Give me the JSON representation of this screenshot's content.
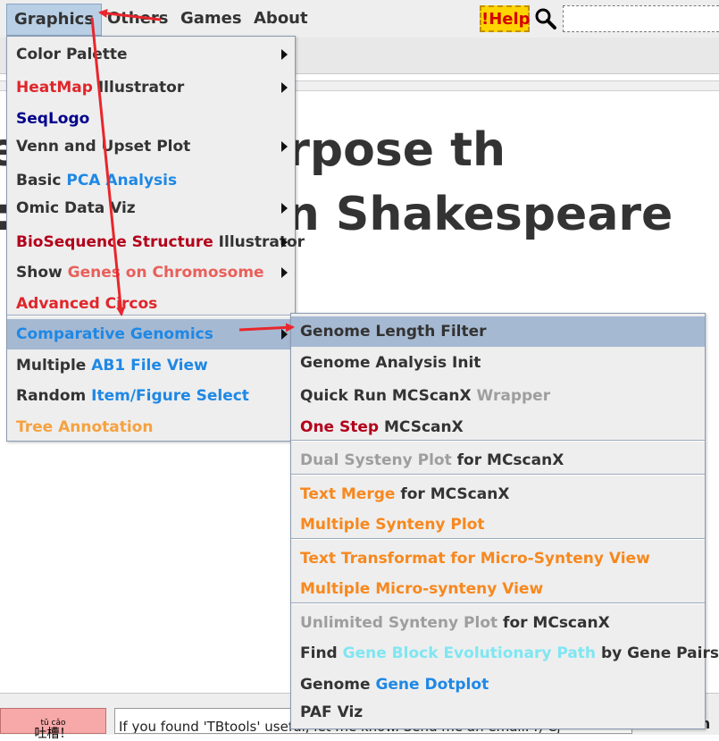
{
  "menubar": {
    "items": [
      "Graphics",
      "Others",
      "Games",
      "About"
    ],
    "help_label": "!Help",
    "search_icon": "magnifier-icon"
  },
  "background": {
    "line1": "e up the purpose th",
    "line2": "lian Shakespeare"
  },
  "graphics_menu": {
    "items": [
      {
        "parts": [
          {
            "t": "Color Palette",
            "c": "dark"
          }
        ],
        "submenu": true
      },
      {
        "parts": [
          {
            "t": "HeatMap",
            "c": "red"
          },
          {
            "t": " Illustrator",
            "c": "dark"
          }
        ],
        "submenu": true
      },
      {
        "parts": [
          {
            "t": "SeqLogo",
            "c": "navy"
          }
        ],
        "submenu": false
      },
      {
        "parts": [
          {
            "t": "Venn and Upset Plot",
            "c": "dark"
          }
        ],
        "submenu": true
      },
      {
        "parts": [
          {
            "t": "Basic ",
            "c": "dark"
          },
          {
            "t": "PCA Analysis",
            "c": "blue"
          }
        ],
        "submenu": false
      },
      {
        "parts": [
          {
            "t": "Omic Data Viz",
            "c": "dark"
          }
        ],
        "submenu": true
      },
      {
        "parts": [
          {
            "t": "BioSequence Structure",
            "c": "darkred"
          },
          {
            "t": " Illustrator",
            "c": "dark"
          }
        ],
        "submenu": true
      },
      {
        "parts": [
          {
            "t": "Show ",
            "c": "dark"
          },
          {
            "t": "Genes on Chromosome",
            "c": "salmon"
          }
        ],
        "submenu": true
      },
      {
        "parts": [
          {
            "t": "Advanced Circos",
            "c": "red"
          }
        ],
        "submenu": false
      },
      {
        "parts": [
          {
            "t": "Comparative Genomics",
            "c": "blue"
          }
        ],
        "submenu": true,
        "highlighted": true
      },
      {
        "parts": [
          {
            "t": "Multiple ",
            "c": "dark"
          },
          {
            "t": "AB1 File View",
            "c": "blue"
          }
        ],
        "submenu": false
      },
      {
        "parts": [
          {
            "t": "Random ",
            "c": "dark"
          },
          {
            "t": "Item/Figure Select",
            "c": "blue"
          }
        ],
        "submenu": false
      },
      {
        "parts": [
          {
            "t": "Tree Annotation",
            "c": "orange"
          }
        ],
        "submenu": false
      }
    ]
  },
  "comparative_submenu": {
    "items": [
      {
        "parts": [
          {
            "t": "Genome Length Filter",
            "c": "dark"
          }
        ],
        "highlighted": true
      },
      {
        "parts": [
          {
            "t": "Genome Analysis Init",
            "c": "dark"
          }
        ]
      },
      {
        "parts": [
          {
            "t": "Quick Run MCScanX ",
            "c": "dark"
          },
          {
            "t": "Wrapper",
            "c": "gray"
          }
        ]
      },
      {
        "parts": [
          {
            "t": "One Step",
            "c": "darkred"
          },
          {
            "t": " MCScanX",
            "c": "dark"
          }
        ]
      },
      {
        "parts": [
          {
            "t": "Dual Systeny Plot",
            "c": "gray"
          },
          {
            "t": " for MCscanX",
            "c": "dark"
          }
        ]
      },
      {
        "parts": [
          {
            "t": "Text Merge",
            "c": "orange2"
          },
          {
            "t": " for MCScanX",
            "c": "dark"
          }
        ]
      },
      {
        "parts": [
          {
            "t": "Multiple Synteny Plot",
            "c": "orange2"
          }
        ]
      },
      {
        "parts": [
          {
            "t": "Text Transformat for Micro-Synteny View",
            "c": "orange2"
          }
        ]
      },
      {
        "parts": [
          {
            "t": "Multiple Micro-synteny View",
            "c": "orange2"
          }
        ]
      },
      {
        "parts": [
          {
            "t": "Unlimited Synteny Plot",
            "c": "gray"
          },
          {
            "t": " for MCscanX",
            "c": "dark"
          }
        ]
      },
      {
        "parts": [
          {
            "t": "Find ",
            "c": "dark"
          },
          {
            "t": "Gene Block Evolutionary Path",
            "c": "cyan"
          },
          {
            "t": " by Gene Pairs",
            "c": "dark"
          }
        ]
      },
      {
        "parts": [
          {
            "t": "Genome ",
            "c": "dark"
          },
          {
            "t": "Gene Dotplot",
            "c": "blue"
          }
        ]
      },
      {
        "parts": [
          {
            "t": "PAF Viz",
            "c": "dark"
          }
        ]
      }
    ]
  },
  "bottom": {
    "donate_ruby": "tū cǎo",
    "donate_label": "吐槽！",
    "message": "If you found 'TBtools' useful, let me know. Send me an email. :) Cj",
    "right_text": "Maximum"
  }
}
